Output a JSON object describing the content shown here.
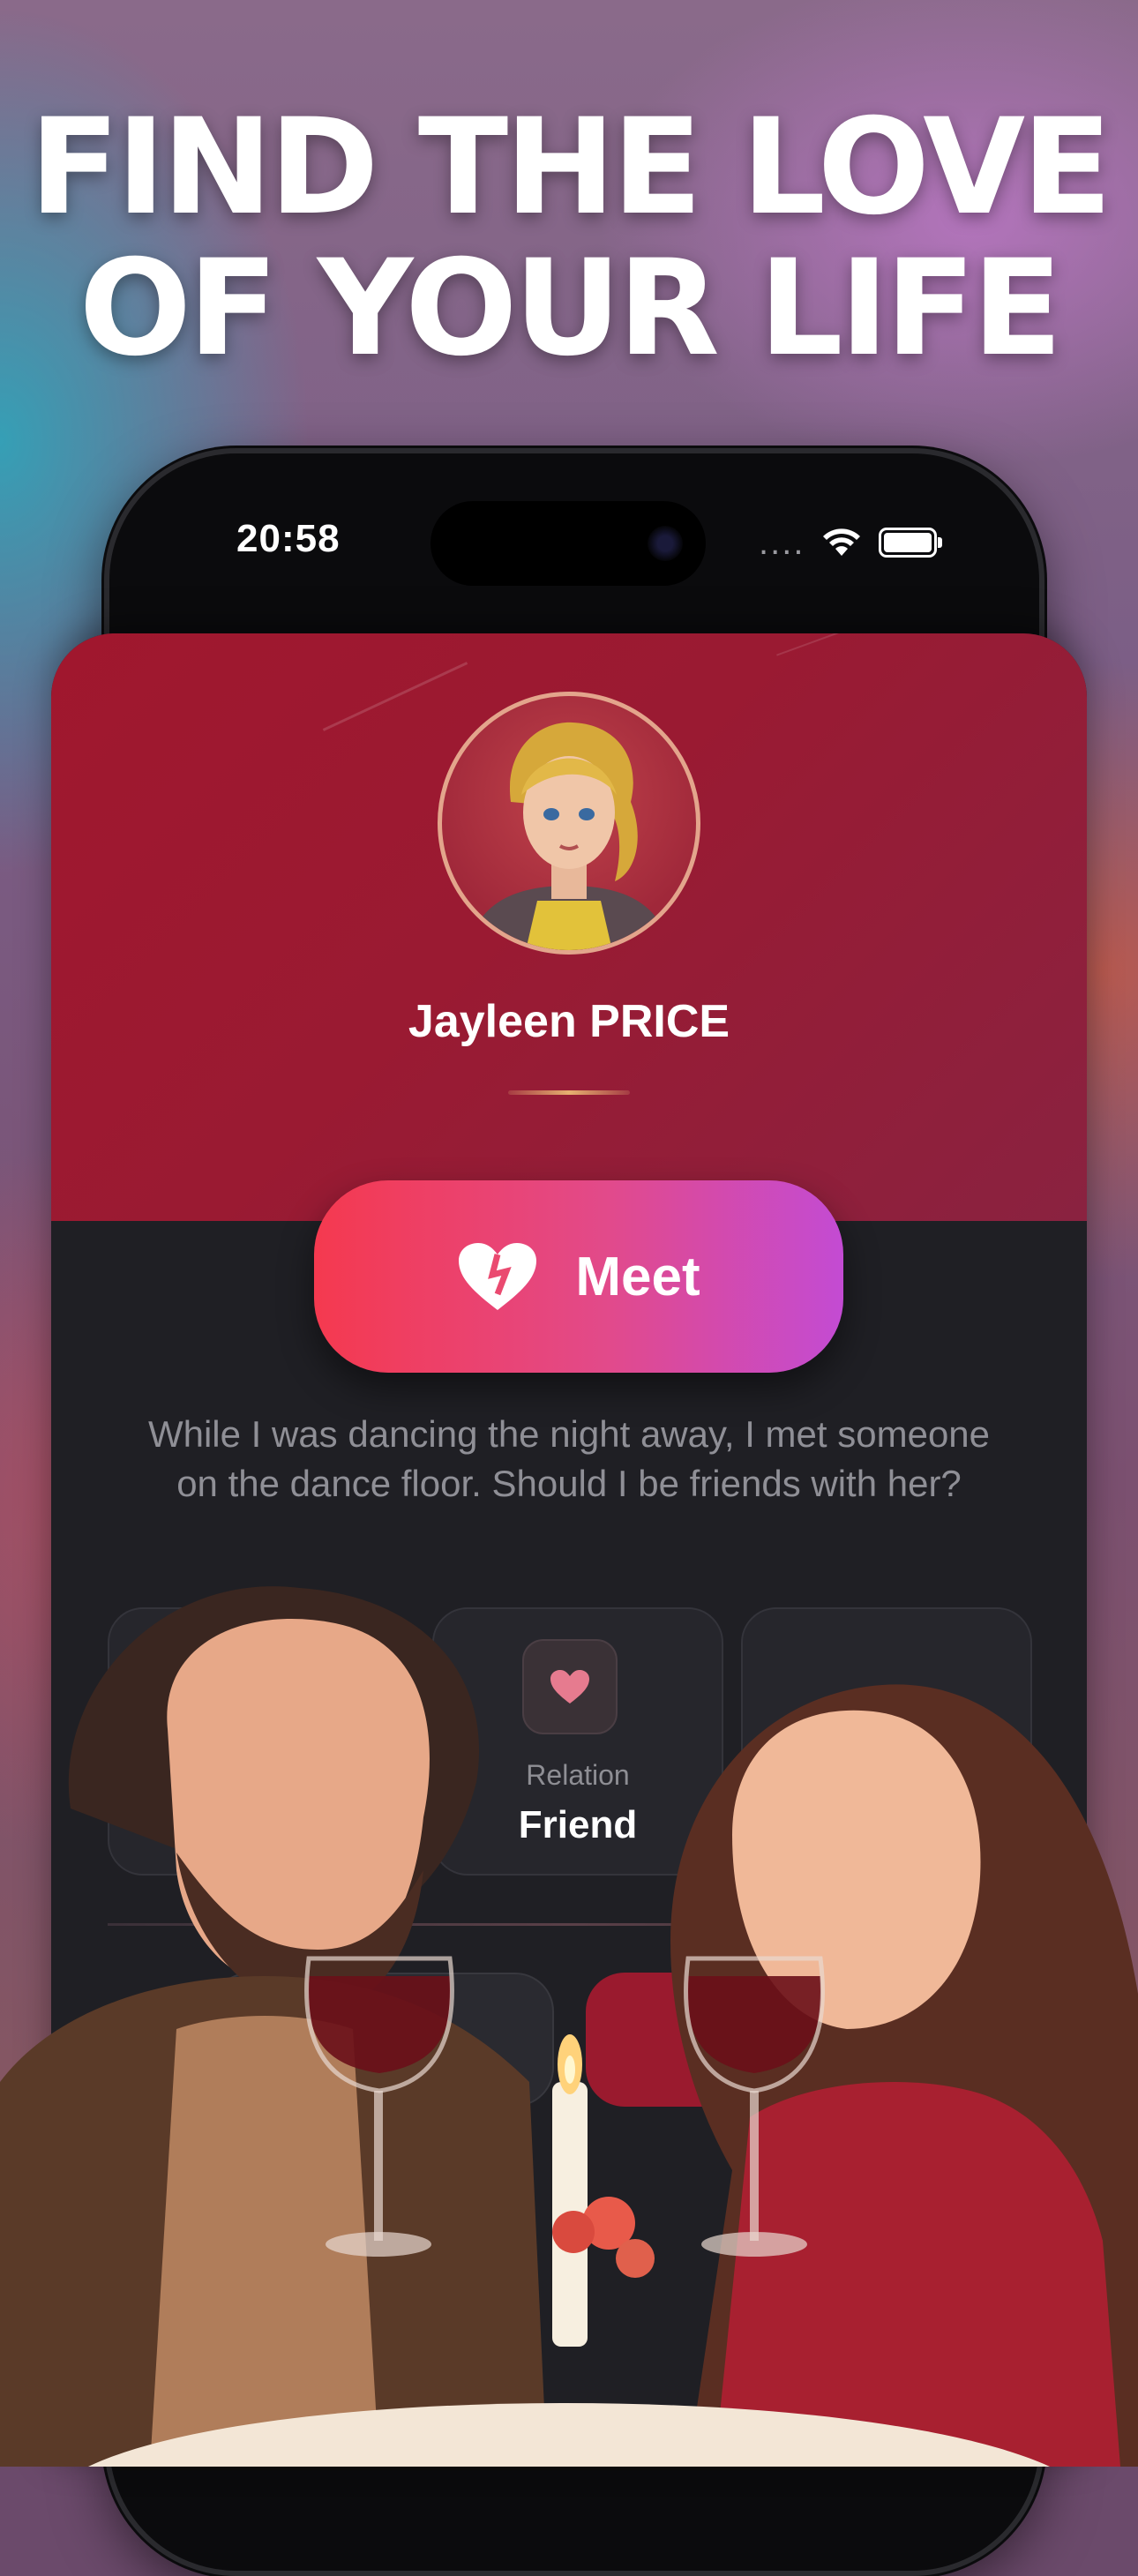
{
  "headline": {
    "line1": "FIND THE LOVE",
    "line2": "OF YOUR LIFE"
  },
  "status_bar": {
    "time": "20:58",
    "dots": "....",
    "icons": [
      "wifi-icon",
      "battery-icon"
    ]
  },
  "profile": {
    "name": "Jayleen PRICE",
    "avatar": "female-character-avatar"
  },
  "actions": {
    "meet_label": "Meet",
    "meet_icon": "heart-icon"
  },
  "story": {
    "text": "While I was dancing the night away, I met someone on the dance floor. Should I be friends with her?"
  },
  "stats": [
    {
      "label": "Relation",
      "value": "Friend",
      "icon": "heart-icon"
    }
  ],
  "colors": {
    "card_top": "#a0172e",
    "card_body": "#1f1f24",
    "meet_gradient_start": "#f5394f",
    "meet_gradient_end": "#c34bd3",
    "heart_icon": "#e67b8f"
  }
}
